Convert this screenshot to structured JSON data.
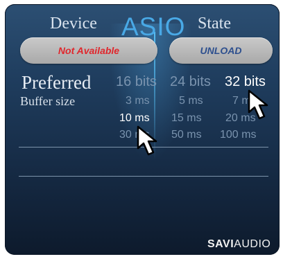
{
  "header": {
    "device_label": "Device",
    "driver_label": "ASIO",
    "state_label": "State"
  },
  "buttons": {
    "device_status": "Not Available",
    "state_action": "UNLOAD"
  },
  "preferred": {
    "label": "Preferred",
    "bit_depths": [
      "16 bits",
      "24 bits",
      "32 bits"
    ],
    "selected_bit_depth": "32 bits"
  },
  "buffer": {
    "label": "Buffer size",
    "options": [
      "3 ms",
      "5 ms",
      "7 ms",
      "10 ms",
      "15 ms",
      "20 ms",
      "30 ms",
      "50 ms",
      "100 ms"
    ],
    "selected": "10 ms"
  },
  "brand": {
    "logo_text_bold": "SAVI",
    "logo_text_rest": "AUDIO"
  },
  "colors": {
    "asio_accent": "#49a9e6",
    "not_available_text": "#e0262c",
    "unload_text": "#2d4f8e",
    "selected_option": "#ffffff",
    "unselected_option": "#7a93ae"
  }
}
